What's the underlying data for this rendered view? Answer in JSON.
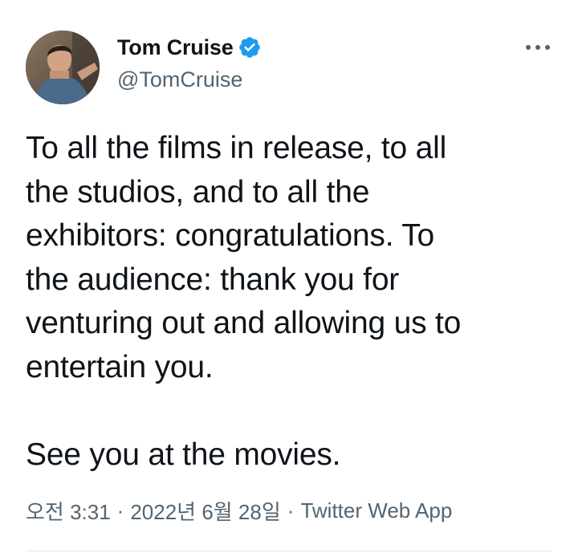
{
  "author": {
    "display_name": "Tom Cruise",
    "handle": "@TomCruise",
    "verified": true,
    "verified_color": "#1d9bf0"
  },
  "tweet": {
    "text": "To all the films in release, to all\nthe studios, and to all the\nexhibitors: congratulations. To\nthe audience: thank you for\nventuring out and allowing us to\nentertain you.\n\nSee you at the movies."
  },
  "meta": {
    "time": "오전 3:31",
    "separator": "·",
    "date": "2022년 6월 28일",
    "source": "Twitter Web App"
  },
  "icons": {
    "more": "more-horizontal-icon",
    "verified": "verified-badge-icon"
  },
  "colors": {
    "text": "#0f1419",
    "secondary": "#536471",
    "divider": "#e1e6ea"
  }
}
